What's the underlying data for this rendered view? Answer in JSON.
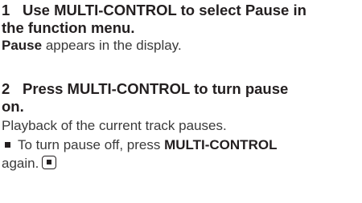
{
  "step1": {
    "number": "1",
    "title_line1": "Use MULTI-CONTROL to select Pause in",
    "title_line2": "the function menu.",
    "desc_bold": "Pause",
    "desc_rest": " appears in the display."
  },
  "step2": {
    "number": "2",
    "title_line1": "Press MULTI-CONTROL to turn pause",
    "title_line2": "on.",
    "desc": "Playback of the current track pauses."
  },
  "note": {
    "line1_prefix": "To turn pause off, press ",
    "line1_bold": "MULTI-CONTROL",
    "line2": "again.",
    "end_mark_icon": "end-square-icon"
  }
}
